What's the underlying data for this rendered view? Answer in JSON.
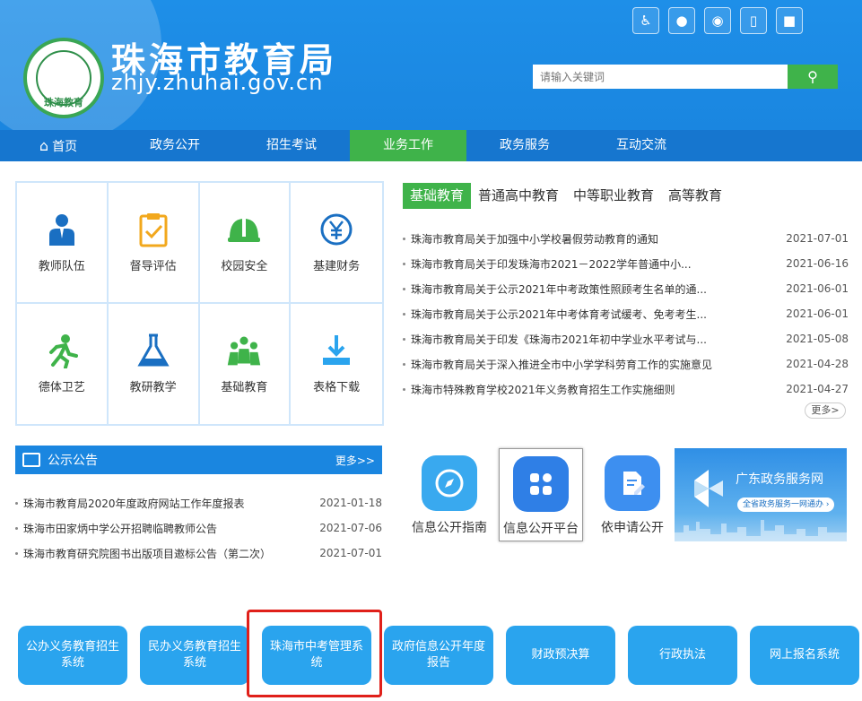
{
  "header": {
    "site_title": "珠海市教育局",
    "site_domain": "zhjy.zhuhai.gov.cn",
    "logo_text": "珠海教育",
    "search_placeholder": "请输入关键词",
    "top_icons": [
      "accessibility-icon",
      "wechat-icon",
      "weibo-icon",
      "mobile-icon",
      "app-icon"
    ]
  },
  "nav": {
    "items": [
      {
        "label": "首页",
        "icon": "home-icon"
      },
      {
        "label": "政务公开"
      },
      {
        "label": "招生考试"
      },
      {
        "label": "业务工作",
        "active": true
      },
      {
        "label": "政务服务"
      },
      {
        "label": "互动交流"
      }
    ]
  },
  "grid": {
    "items": [
      {
        "label": "教师队伍",
        "icon": "teacher-icon"
      },
      {
        "label": "督导评估",
        "icon": "clipboard-check-icon"
      },
      {
        "label": "校园安全",
        "icon": "helmet-icon"
      },
      {
        "label": "基建财务",
        "icon": "yen-icon"
      },
      {
        "label": "德体卫艺",
        "icon": "runner-icon"
      },
      {
        "label": "教研教学",
        "icon": "flask-icon"
      },
      {
        "label": "基础教育",
        "icon": "people-icon"
      },
      {
        "label": "表格下载",
        "icon": "download-icon"
      }
    ]
  },
  "news": {
    "tabs": [
      "基础教育",
      "普通高中教育",
      "中等职业教育",
      "高等教育"
    ],
    "items": [
      {
        "title": "珠海市教育局关于加强中小学校暑假劳动教育的通知",
        "date": "2021-07-01"
      },
      {
        "title": "珠海市教育局关于印发珠海市2021－2022学年普通中小...",
        "date": "2021-06-16"
      },
      {
        "title": "珠海市教育局关于公示2021年中考政策性照顾考生名单的通...",
        "date": "2021-06-01"
      },
      {
        "title": "珠海市教育局关于公示2021年中考体育考试缓考、免考考生...",
        "date": "2021-06-01"
      },
      {
        "title": "珠海市教育局关于印发《珠海市2021年初中学业水平考试与...",
        "date": "2021-05-08"
      },
      {
        "title": "珠海市教育局关于深入推进全市中小学学科劳育工作的实施意见",
        "date": "2021-04-28"
      },
      {
        "title": "珠海市特殊教育学校2021年义务教育招生工作实施细则",
        "date": "2021-04-27"
      }
    ],
    "more": "更多>"
  },
  "notice": {
    "title": "公示公告",
    "more": "更多>>",
    "items": [
      {
        "title": "珠海市教育局2020年度政府网站工作年度报表",
        "date": "2021-01-18"
      },
      {
        "title": "珠海市田家炳中学公开招聘临聘教师公告",
        "date": "2021-07-06"
      },
      {
        "title": "珠海市教育研究院图书出版项目邀标公告（第二次）",
        "date": "2021-07-01"
      }
    ]
  },
  "apps": {
    "items": [
      {
        "label": "信息公开指南",
        "icon": "compass-icon",
        "color": "#39a9ef"
      },
      {
        "label": "信息公开平台",
        "icon": "grid-apps-icon",
        "color": "#2f7fe6",
        "selected": true
      },
      {
        "label": "依申请公开",
        "icon": "document-edit-icon",
        "color": "#3d8ff0"
      }
    ],
    "banner": {
      "title": "广东政务服务网",
      "subtitle": "全省政务服务一网通办 ›"
    }
  },
  "bottom_buttons": {
    "items": [
      {
        "label": "公办义务教育招生系统"
      },
      {
        "label": "民办义务教育招生系统"
      },
      {
        "label": "珠海市中考管理系统",
        "highlighted": true
      },
      {
        "label": "政府信息公开年度报告"
      },
      {
        "label": "财政预决算"
      },
      {
        "label": "行政执法"
      },
      {
        "label": "网上报名系统"
      }
    ]
  },
  "colors": {
    "header_blue": "#1e8fe8",
    "nav_blue": "#1676cf",
    "accent_green": "#3fb34a",
    "button_blue": "#2aa4ee",
    "highlight_red": "#e0201a"
  }
}
